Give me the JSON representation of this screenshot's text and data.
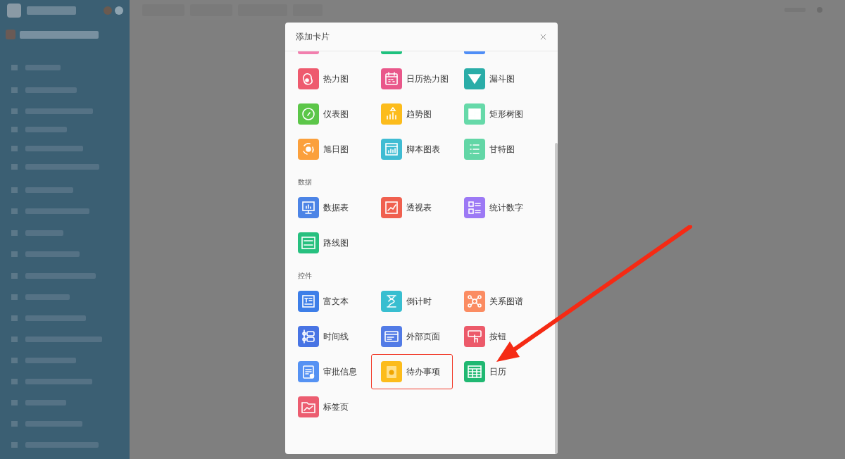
{
  "dialog": {
    "title": "添加卡片",
    "sections": [
      {
        "items": [
          {
            "kind": "partial",
            "color": "#f27fae"
          },
          {
            "kind": "partial",
            "color": "#1ec27e"
          },
          {
            "kind": "partial",
            "color": "#4f8ef7"
          },
          {
            "label": "热力图",
            "kind": "blob",
            "color": "#ee5a6e",
            "highlighted": false
          },
          {
            "label": "日历热力图",
            "kind": "calendar",
            "color": "#e9578a",
            "highlighted": false
          },
          {
            "label": "漏斗图",
            "kind": "funnel",
            "color": "#2aada8",
            "highlighted": false
          },
          {
            "label": "仪表图",
            "kind": "gauge",
            "color": "#5cc649",
            "highlighted": false
          },
          {
            "label": "趋势图",
            "kind": "rising-bars",
            "color": "#fcbc1c",
            "highlighted": false
          },
          {
            "label": "矩形树图",
            "kind": "tiles",
            "color": "#66d9a9",
            "highlighted": false
          },
          {
            "label": "旭日图",
            "kind": "sunburst",
            "color": "#fba03c",
            "highlighted": false
          },
          {
            "label": "脚本图表",
            "kind": "window-chart",
            "color": "#3fbcd3",
            "highlighted": false
          },
          {
            "label": "甘特图",
            "kind": "list",
            "color": "#62d6a6",
            "highlighted": false
          }
        ]
      },
      {
        "title": "数据",
        "items": [
          {
            "label": "数据表",
            "kind": "monitor-chart",
            "color": "#4c84e6",
            "highlighted": false
          },
          {
            "label": "透视表",
            "kind": "framed-chart",
            "color": "#f0604f",
            "highlighted": false
          },
          {
            "label": "统计数字",
            "kind": "stat-list",
            "color": "#9c79f5",
            "highlighted": false
          },
          {
            "label": "路线图",
            "kind": "route",
            "color": "#27c07f",
            "highlighted": false
          }
        ]
      },
      {
        "title": "控件",
        "items": [
          {
            "label": "富文本",
            "kind": "text-doc",
            "color": "#3d7ee8",
            "highlighted": false
          },
          {
            "label": "倒计时",
            "kind": "hourglass",
            "color": "#38bed0",
            "highlighted": false
          },
          {
            "label": "关系图谱",
            "kind": "nodes",
            "color": "#fb8c62",
            "highlighted": false
          },
          {
            "label": "时间线",
            "kind": "timeline",
            "color": "#4874e4",
            "highlighted": false
          },
          {
            "label": "外部页面",
            "kind": "window",
            "color": "#527be6",
            "highlighted": false
          },
          {
            "label": "按钮",
            "kind": "hand-button",
            "color": "#ec5a6a",
            "highlighted": false
          },
          {
            "label": "审批信息",
            "kind": "clipboard",
            "color": "#5592f3",
            "highlighted": false
          },
          {
            "label": "待办事项",
            "kind": "clipboard-clock",
            "color": "#fcbc1c",
            "highlighted": true
          },
          {
            "label": "日历",
            "kind": "grid-table",
            "color": "#20b872",
            "highlighted": false
          },
          {
            "label": "标签页",
            "kind": "folder-chart",
            "color": "#ec5d70",
            "highlighted": false
          }
        ]
      }
    ]
  }
}
